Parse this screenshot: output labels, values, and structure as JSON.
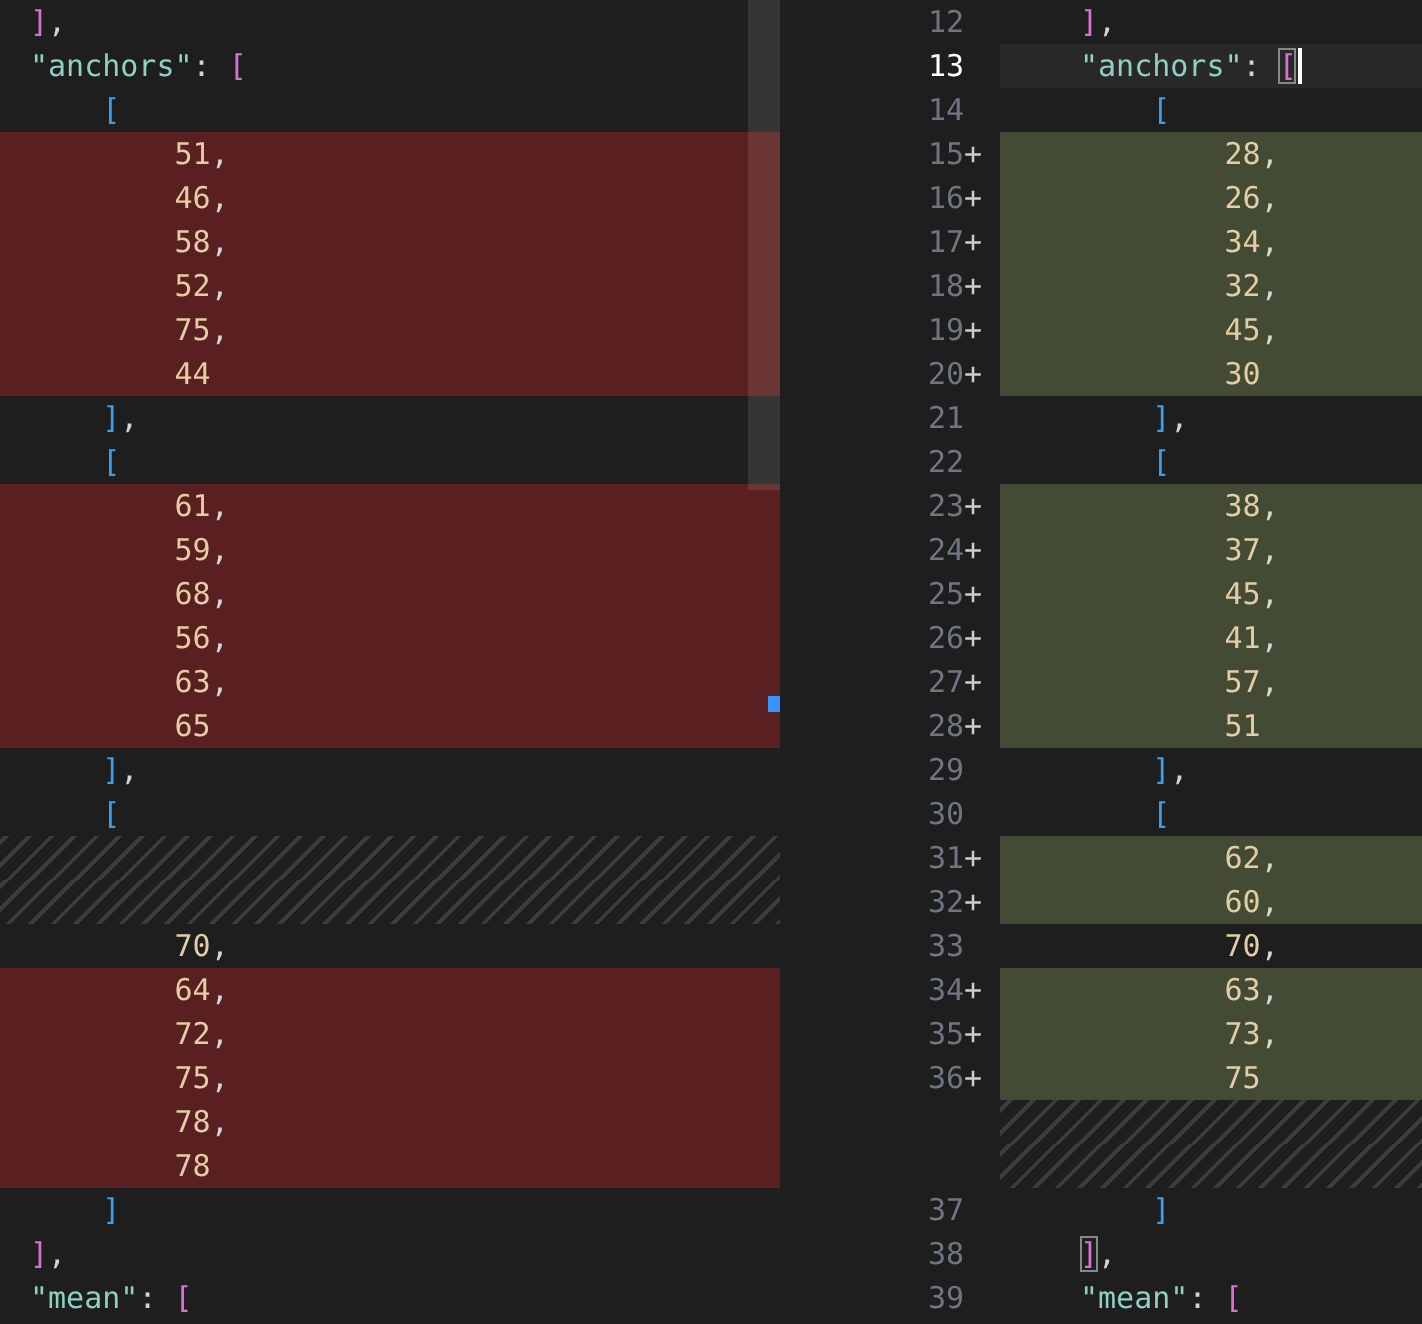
{
  "panes": [
    {
      "lines": [
        {
          "kind": "context",
          "tokens": [
            {
              "kind": "bracket1",
              "text": "]"
            },
            {
              "kind": "punct",
              "text": ","
            }
          ]
        },
        {
          "kind": "context",
          "tokens": [
            {
              "kind": "key",
              "text": "\"anchors\""
            },
            {
              "kind": "punct",
              "text": ": "
            },
            {
              "kind": "bracket1",
              "text": "["
            }
          ]
        },
        {
          "kind": "context",
          "tokens": [
            {
              "kind": "bracket2",
              "text": "    ["
            }
          ]
        },
        {
          "kind": "removed",
          "tokens": [
            {
              "kind": "number",
              "text": "        51"
            },
            {
              "kind": "punct",
              "text": ","
            }
          ]
        },
        {
          "kind": "removed",
          "tokens": [
            {
              "kind": "number",
              "text": "        46"
            },
            {
              "kind": "punct",
              "text": ","
            }
          ]
        },
        {
          "kind": "removed",
          "tokens": [
            {
              "kind": "number",
              "text": "        58"
            },
            {
              "kind": "punct",
              "text": ","
            }
          ]
        },
        {
          "kind": "removed",
          "tokens": [
            {
              "kind": "number",
              "text": "        52"
            },
            {
              "kind": "punct",
              "text": ","
            }
          ]
        },
        {
          "kind": "removed",
          "tokens": [
            {
              "kind": "number",
              "text": "        75"
            },
            {
              "kind": "punct",
              "text": ","
            }
          ]
        },
        {
          "kind": "removed",
          "tokens": [
            {
              "kind": "number",
              "text": "        44"
            }
          ]
        },
        {
          "kind": "context",
          "tokens": [
            {
              "kind": "bracket2",
              "text": "    ]"
            },
            {
              "kind": "punct",
              "text": ","
            }
          ]
        },
        {
          "kind": "context",
          "tokens": [
            {
              "kind": "bracket2",
              "text": "    ["
            }
          ]
        },
        {
          "kind": "removed",
          "tokens": [
            {
              "kind": "number",
              "text": "        61"
            },
            {
              "kind": "punct",
              "text": ","
            }
          ]
        },
        {
          "kind": "removed",
          "tokens": [
            {
              "kind": "number",
              "text": "        59"
            },
            {
              "kind": "punct",
              "text": ","
            }
          ]
        },
        {
          "kind": "removed",
          "tokens": [
            {
              "kind": "number",
              "text": "        68"
            },
            {
              "kind": "punct",
              "text": ","
            }
          ]
        },
        {
          "kind": "removed",
          "tokens": [
            {
              "kind": "number",
              "text": "        56"
            },
            {
              "kind": "punct",
              "text": ","
            }
          ]
        },
        {
          "kind": "removed",
          "tokens": [
            {
              "kind": "number",
              "text": "        63"
            },
            {
              "kind": "punct",
              "text": ","
            }
          ]
        },
        {
          "kind": "removed",
          "tokens": [
            {
              "kind": "number",
              "text": "        65"
            }
          ]
        },
        {
          "kind": "context",
          "tokens": [
            {
              "kind": "bracket2",
              "text": "    ]"
            },
            {
              "kind": "punct",
              "text": ","
            }
          ]
        },
        {
          "kind": "context",
          "tokens": [
            {
              "kind": "bracket2",
              "text": "    ["
            }
          ]
        },
        {
          "kind": "filler"
        },
        {
          "kind": "filler"
        },
        {
          "kind": "context",
          "tokens": [
            {
              "kind": "number",
              "text": "        70"
            },
            {
              "kind": "punct",
              "text": ","
            }
          ]
        },
        {
          "kind": "removed",
          "tokens": [
            {
              "kind": "number",
              "text": "        64"
            },
            {
              "kind": "punct",
              "text": ","
            }
          ]
        },
        {
          "kind": "removed",
          "tokens": [
            {
              "kind": "number",
              "text": "        72"
            },
            {
              "kind": "punct",
              "text": ","
            }
          ]
        },
        {
          "kind": "removed",
          "tokens": [
            {
              "kind": "number",
              "text": "        75"
            },
            {
              "kind": "punct",
              "text": ","
            }
          ]
        },
        {
          "kind": "removed",
          "tokens": [
            {
              "kind": "number",
              "text": "        78"
            },
            {
              "kind": "punct",
              "text": ","
            }
          ]
        },
        {
          "kind": "removed",
          "tokens": [
            {
              "kind": "number",
              "text": "        78"
            }
          ]
        },
        {
          "kind": "context",
          "tokens": [
            {
              "kind": "bracket2",
              "text": "    ]"
            }
          ]
        },
        {
          "kind": "context",
          "tokens": [
            {
              "kind": "bracket1",
              "text": "]"
            },
            {
              "kind": "punct",
              "text": ","
            }
          ]
        },
        {
          "kind": "context",
          "tokens": [
            {
              "kind": "key",
              "text": "\"mean\""
            },
            {
              "kind": "punct",
              "text": ": "
            },
            {
              "kind": "bracket1",
              "text": "["
            }
          ]
        }
      ]
    },
    {
      "lines": [
        {
          "kind": "context",
          "number": "12",
          "tokens": [
            {
              "kind": "bracket1",
              "text": "]"
            },
            {
              "kind": "punct",
              "text": ","
            }
          ]
        },
        {
          "kind": "context",
          "number": "13",
          "current": true,
          "tokens": [
            {
              "kind": "key",
              "text": "\"anchors\""
            },
            {
              "kind": "punct",
              "text": ": "
            },
            {
              "kind": "bracket1",
              "text": "[",
              "matched": true
            }
          ]
        },
        {
          "kind": "context",
          "number": "14",
          "tokens": [
            {
              "kind": "bracket2",
              "text": "    ["
            }
          ]
        },
        {
          "kind": "added",
          "number": "15",
          "marker": "+",
          "tokens": [
            {
              "kind": "number",
              "text": "        28"
            },
            {
              "kind": "punct",
              "text": ","
            }
          ]
        },
        {
          "kind": "added",
          "number": "16",
          "marker": "+",
          "tokens": [
            {
              "kind": "number",
              "text": "        26"
            },
            {
              "kind": "punct",
              "text": ","
            }
          ]
        },
        {
          "kind": "added",
          "number": "17",
          "marker": "+",
          "tokens": [
            {
              "kind": "number",
              "text": "        34"
            },
            {
              "kind": "punct",
              "text": ","
            }
          ]
        },
        {
          "kind": "added",
          "number": "18",
          "marker": "+",
          "tokens": [
            {
              "kind": "number",
              "text": "        32"
            },
            {
              "kind": "punct",
              "text": ","
            }
          ]
        },
        {
          "kind": "added",
          "number": "19",
          "marker": "+",
          "tokens": [
            {
              "kind": "number",
              "text": "        45"
            },
            {
              "kind": "punct",
              "text": ","
            }
          ]
        },
        {
          "kind": "added",
          "number": "20",
          "marker": "+",
          "tokens": [
            {
              "kind": "number",
              "text": "        30"
            }
          ]
        },
        {
          "kind": "context",
          "number": "21",
          "tokens": [
            {
              "kind": "bracket2",
              "text": "    ]"
            },
            {
              "kind": "punct",
              "text": ","
            }
          ]
        },
        {
          "kind": "context",
          "number": "22",
          "tokens": [
            {
              "kind": "bracket2",
              "text": "    ["
            }
          ]
        },
        {
          "kind": "added",
          "number": "23",
          "marker": "+",
          "tokens": [
            {
              "kind": "number",
              "text": "        38"
            },
            {
              "kind": "punct",
              "text": ","
            }
          ]
        },
        {
          "kind": "added",
          "number": "24",
          "marker": "+",
          "tokens": [
            {
              "kind": "number",
              "text": "        37"
            },
            {
              "kind": "punct",
              "text": ","
            }
          ]
        },
        {
          "kind": "added",
          "number": "25",
          "marker": "+",
          "tokens": [
            {
              "kind": "number",
              "text": "        45"
            },
            {
              "kind": "punct",
              "text": ","
            }
          ]
        },
        {
          "kind": "added",
          "number": "26",
          "marker": "+",
          "tokens": [
            {
              "kind": "number",
              "text": "        41"
            },
            {
              "kind": "punct",
              "text": ","
            }
          ]
        },
        {
          "kind": "added",
          "number": "27",
          "marker": "+",
          "tokens": [
            {
              "kind": "number",
              "text": "        57"
            },
            {
              "kind": "punct",
              "text": ","
            }
          ]
        },
        {
          "kind": "added",
          "number": "28",
          "marker": "+",
          "tokens": [
            {
              "kind": "number",
              "text": "        51"
            }
          ]
        },
        {
          "kind": "context",
          "number": "29",
          "tokens": [
            {
              "kind": "bracket2",
              "text": "    ]"
            },
            {
              "kind": "punct",
              "text": ","
            }
          ]
        },
        {
          "kind": "context",
          "number": "30",
          "tokens": [
            {
              "kind": "bracket2",
              "text": "    ["
            }
          ]
        },
        {
          "kind": "added",
          "number": "31",
          "marker": "+",
          "tokens": [
            {
              "kind": "number",
              "text": "        62"
            },
            {
              "kind": "punct",
              "text": ","
            }
          ]
        },
        {
          "kind": "added",
          "number": "32",
          "marker": "+",
          "tokens": [
            {
              "kind": "number",
              "text": "        60"
            },
            {
              "kind": "punct",
              "text": ","
            }
          ]
        },
        {
          "kind": "context",
          "number": "33",
          "tokens": [
            {
              "kind": "number",
              "text": "        70"
            },
            {
              "kind": "punct",
              "text": ","
            }
          ]
        },
        {
          "kind": "added",
          "number": "34",
          "marker": "+",
          "tokens": [
            {
              "kind": "number",
              "text": "        63"
            },
            {
              "kind": "punct",
              "text": ","
            }
          ]
        },
        {
          "kind": "added",
          "number": "35",
          "marker": "+",
          "tokens": [
            {
              "kind": "number",
              "text": "        73"
            },
            {
              "kind": "punct",
              "text": ","
            }
          ]
        },
        {
          "kind": "added",
          "number": "36",
          "marker": "+",
          "tokens": [
            {
              "kind": "number",
              "text": "        75"
            }
          ]
        },
        {
          "kind": "filler"
        },
        {
          "kind": "filler"
        },
        {
          "kind": "context",
          "number": "37",
          "tokens": [
            {
              "kind": "bracket2",
              "text": "    ]"
            }
          ]
        },
        {
          "kind": "context",
          "number": "38",
          "tokens": [
            {
              "kind": "bracket1",
              "text": "]",
              "matched": true
            },
            {
              "kind": "punct",
              "text": ","
            }
          ]
        },
        {
          "kind": "context",
          "number": "39",
          "tokens": [
            {
              "kind": "key",
              "text": "\"mean\""
            },
            {
              "kind": "punct",
              "text": ": "
            },
            {
              "kind": "bracket1",
              "text": "["
            }
          ]
        }
      ]
    }
  ]
}
